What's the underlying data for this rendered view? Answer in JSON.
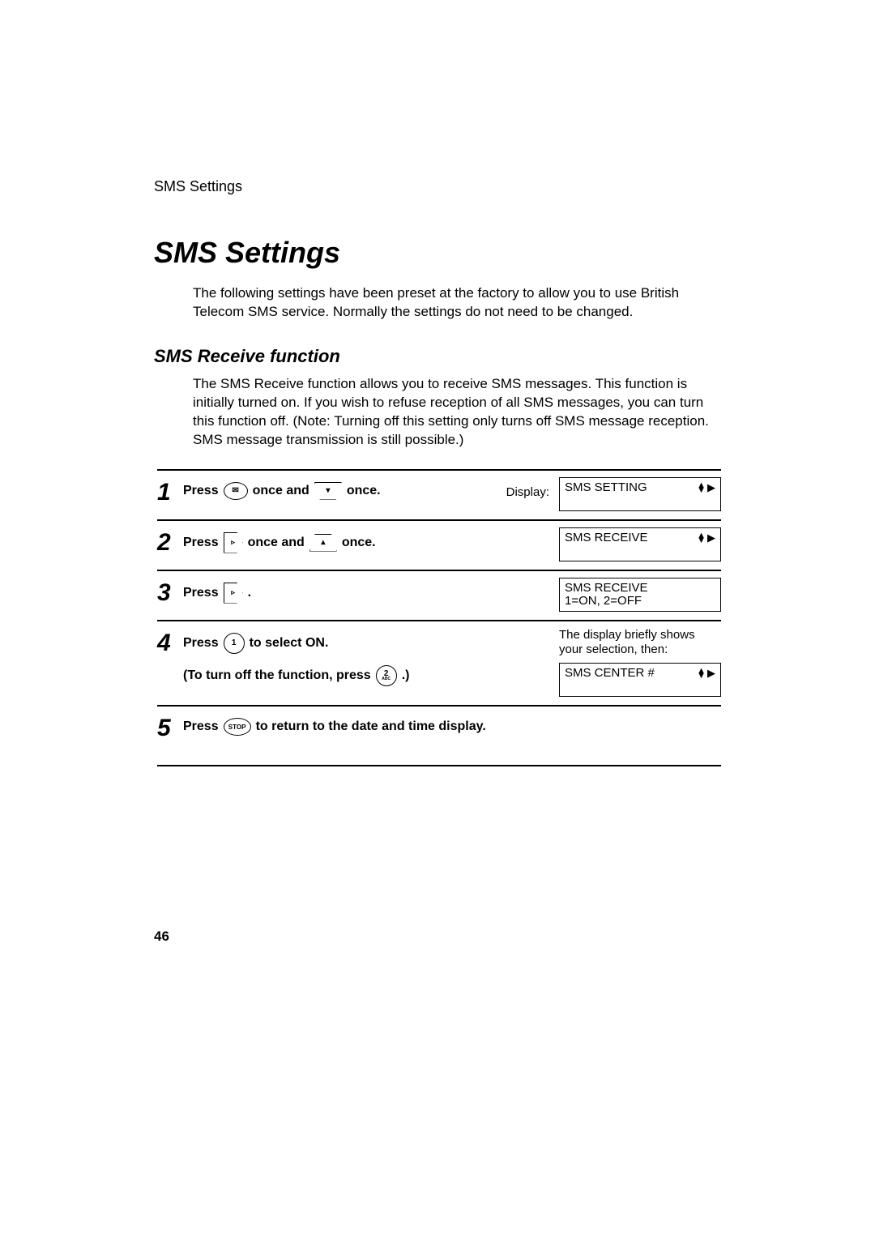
{
  "running_head": "SMS Settings",
  "title": "SMS Settings",
  "intro": "The following settings have been preset at the factory to allow you to use British Telecom SMS service. Normally the settings do not need to be changed.",
  "subhead": "SMS Receive function",
  "subintro": "The SMS Receive function allows you to receive SMS messages. This function is initially turned on. If you wish to refuse reception of all SMS messages, you can turn this function off. (Note: Turning off this setting only turns off SMS message reception. SMS message transmission is still possible.)",
  "steps": {
    "s1": {
      "num": "1",
      "t1": "Press",
      "t2": "once and",
      "t3": "once.",
      "display_label": "Display:",
      "lcd": "SMS SETTING"
    },
    "s2": {
      "num": "2",
      "t1": "Press",
      "t2": "once and",
      "t3": "once.",
      "lcd": "SMS RECEIVE"
    },
    "s3": {
      "num": "3",
      "t1": "Press",
      "t2": ".",
      "lcd": "SMS RECEIVE\n1=ON, 2=OFF"
    },
    "s4": {
      "num": "4",
      "t1": "Press",
      "t2": "to select ON.",
      "t3": "(To turn off the function, press",
      "t4": ".)",
      "note": "The display briefly shows your selection, then:",
      "lcd": "SMS CENTER #"
    },
    "s5": {
      "num": "5",
      "t1": "Press",
      "t2": "to return to the date and time display."
    }
  },
  "keys": {
    "sms": "✉",
    "down": "▾",
    "up": "▴",
    "right": "▹",
    "one": "1",
    "two": "2",
    "two_sub": "ABC",
    "stop": "STOP"
  },
  "page_number": "46"
}
